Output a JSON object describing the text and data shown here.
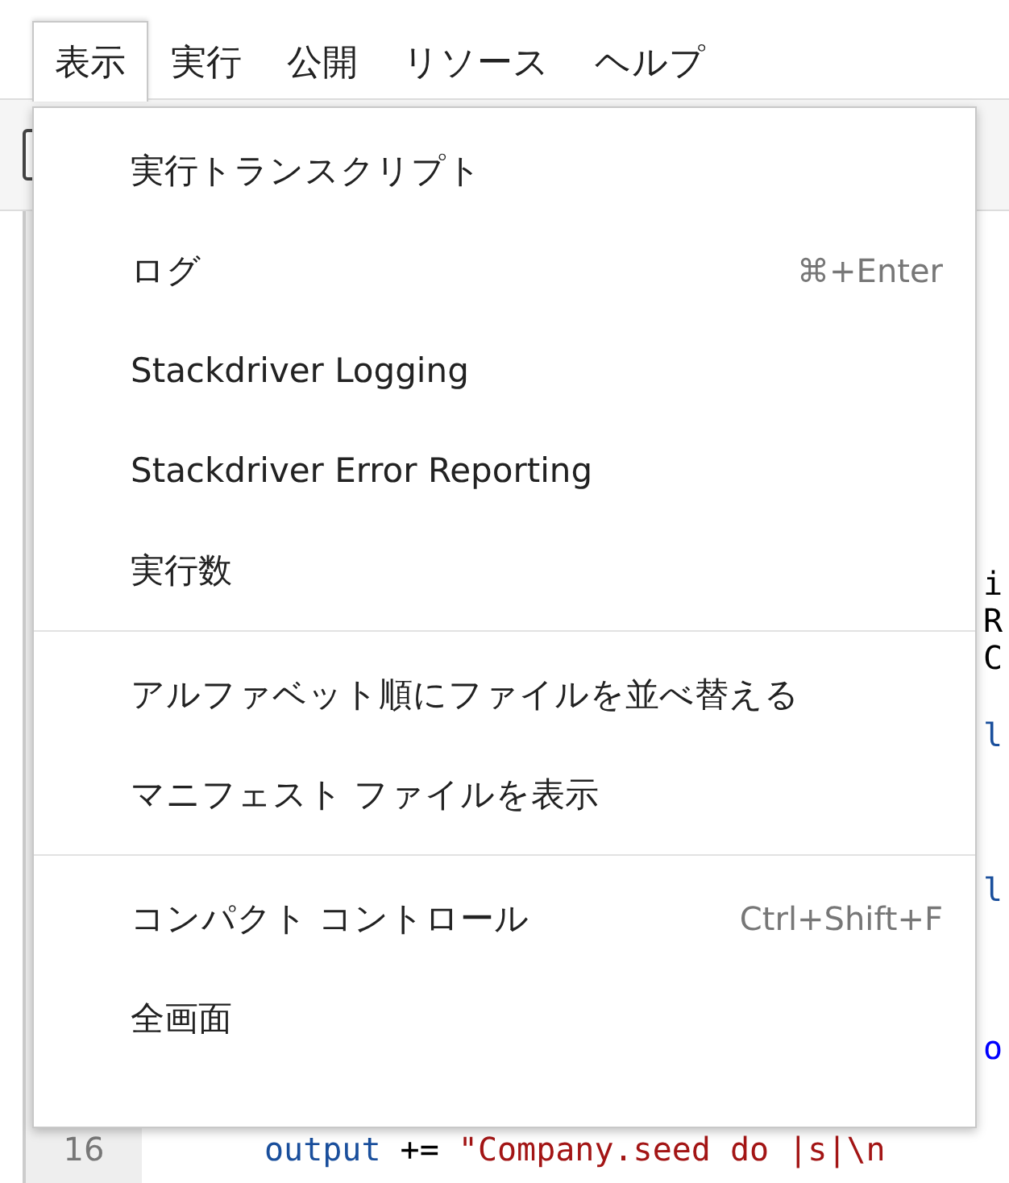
{
  "menubar": [
    {
      "label": "表示",
      "selected": true
    },
    {
      "label": "実行",
      "selected": false
    },
    {
      "label": "公開",
      "selected": false
    },
    {
      "label": "リソース",
      "selected": false
    },
    {
      "label": "ヘルプ",
      "selected": false
    }
  ],
  "menu": {
    "groups": [
      [
        {
          "label": "実行トランスクリプト"
        },
        {
          "label": "ログ",
          "shortcut": "⌘+Enter"
        },
        {
          "label": "Stackdriver Logging"
        },
        {
          "label": "Stackdriver Error Reporting"
        },
        {
          "label": "実行数"
        }
      ],
      [
        {
          "label": "アルファベット順にファイルを並べ替える"
        },
        {
          "label": "マニフェスト ファイルを表示"
        }
      ],
      [
        {
          "label": "コンパクト コントロール",
          "shortcut": "Ctrl+Shift+F"
        },
        {
          "label": "全画面"
        }
      ]
    ]
  },
  "editor": {
    "lines": [
      {
        "text": "i",
        "kind": "plain"
      },
      {
        "text": "R",
        "kind": "plain"
      },
      {
        "text": "C",
        "kind": "plain"
      },
      {
        "text": "l",
        "kind": "keyword"
      },
      {
        "text": "l",
        "kind": "keyword"
      },
      {
        "text": "o",
        "kind": "variable"
      },
      {
        "number": "16",
        "parts": [
          {
            "text": "output",
            "kind": "keyword"
          },
          {
            "text": " += ",
            "kind": "plain"
          },
          {
            "text": "\"Company.seed do |s|\\n",
            "kind": "string"
          }
        ]
      }
    ]
  }
}
